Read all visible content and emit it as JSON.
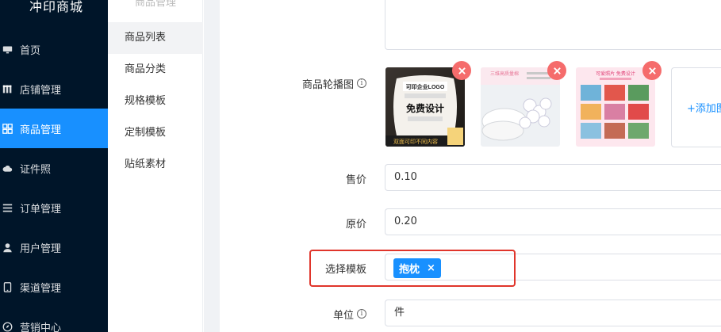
{
  "sidebar": {
    "brand": "冲印商城",
    "items": [
      {
        "label": "首页",
        "icon": "monitor-icon"
      },
      {
        "label": "店铺管理",
        "icon": "store-icon"
      },
      {
        "label": "商品管理",
        "icon": "apps-icon",
        "active": true
      },
      {
        "label": "证件照",
        "icon": "cloud-icon"
      },
      {
        "label": "订单管理",
        "icon": "list-icon"
      },
      {
        "label": "用户管理",
        "icon": "user-icon"
      },
      {
        "label": "渠道管理",
        "icon": "phone-icon"
      },
      {
        "label": "营销中心",
        "icon": "compass-icon"
      }
    ]
  },
  "submenu": {
    "title": "商品管理",
    "items": [
      {
        "label": "商品列表",
        "active": true
      },
      {
        "label": "商品分类"
      },
      {
        "label": "规格模板"
      },
      {
        "label": "定制模板"
      },
      {
        "label": "贴纸素材"
      }
    ]
  },
  "form": {
    "carousel": {
      "label": "商品轮播图",
      "add_label": "+添加图",
      "images": [
        {
          "caption_top": "可印企业LOGO",
          "caption_mid": "免费设计",
          "caption_bottom": "双面可印不同内容"
        },
        {
          "caption_top": "三维高质量棉",
          "caption_mid": "",
          "caption_bottom": ""
        },
        {
          "caption_top": "可爱照片 免费设计",
          "caption_mid": "",
          "caption_bottom": ""
        }
      ]
    },
    "price": {
      "label": "售价",
      "value": "0.10"
    },
    "original_price": {
      "label": "原价",
      "value": "0.20"
    },
    "template": {
      "label": "选择模板",
      "tag": "抱枕",
      "tag_close": "×"
    },
    "unit": {
      "label": "单位",
      "value": "件"
    }
  },
  "colors": {
    "sidebar_bg": "#001529",
    "accent": "#1890ff",
    "delete": "#f56c6c",
    "highlight": "#e0352b"
  }
}
